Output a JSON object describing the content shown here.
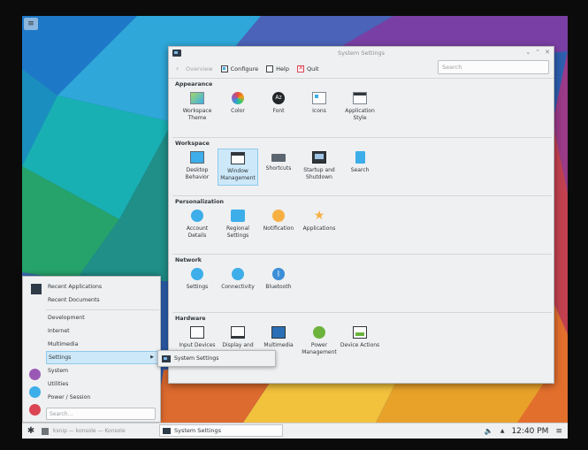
{
  "window": {
    "title": "System Settings",
    "toolbar": {
      "overview": "Overview",
      "configure": "Configure",
      "help": "Help",
      "quit": "Quit"
    },
    "search_placeholder": "Search"
  },
  "sections": [
    {
      "title": "Appearance",
      "items": [
        {
          "label": "Workspace Theme",
          "icon": "workspace-theme-icon"
        },
        {
          "label": "Color",
          "icon": "color-icon"
        },
        {
          "label": "Font",
          "icon": "font-icon",
          "glyph": "Az"
        },
        {
          "label": "Icons",
          "icon": "icons-icon"
        },
        {
          "label": "Application Style",
          "icon": "application-style-icon"
        }
      ]
    },
    {
      "title": "Workspace",
      "items": [
        {
          "label": "Desktop Behavior",
          "icon": "desktop-behavior-icon"
        },
        {
          "label": "Window Management",
          "icon": "window-management-icon",
          "selected": true
        },
        {
          "label": "Shortcuts",
          "icon": "shortcuts-icon"
        },
        {
          "label": "Startup and Shutdown",
          "icon": "startup-shutdown-icon"
        },
        {
          "label": "Search",
          "icon": "search-icon"
        }
      ]
    },
    {
      "title": "Personalization",
      "items": [
        {
          "label": "Account Details",
          "icon": "account-details-icon"
        },
        {
          "label": "Regional Settings",
          "icon": "regional-settings-icon"
        },
        {
          "label": "Notification",
          "icon": "notification-icon"
        },
        {
          "label": "Applications",
          "icon": "applications-star-icon",
          "glyph": "★"
        }
      ]
    },
    {
      "title": "Network",
      "items": [
        {
          "label": "Settings",
          "icon": "network-settings-icon"
        },
        {
          "label": "Connectivity",
          "icon": "connectivity-icon"
        },
        {
          "label": "Bluetooth",
          "icon": "bluetooth-icon",
          "glyph": "ᛒ"
        }
      ]
    },
    {
      "title": "Hardware",
      "items": [
        {
          "label": "Input Devices",
          "icon": "input-devices-icon"
        },
        {
          "label": "Display and",
          "icon": "display-icon"
        },
        {
          "label": "Multimedia",
          "icon": "multimedia-icon"
        },
        {
          "label": "Power Management",
          "icon": "power-management-icon"
        },
        {
          "label": "Device Actions",
          "icon": "device-actions-icon"
        }
      ]
    }
  ],
  "launcher": {
    "recent_applications": "Recent Applications",
    "recent_documents": "Recent Documents",
    "categories": [
      "Development",
      "Internet",
      "Multimedia",
      "Settings",
      "System",
      "Utilities",
      "Power / Session"
    ],
    "active_category": "Settings",
    "search_placeholder": "Search..."
  },
  "submenu": {
    "item": "System Settings"
  },
  "panel": {
    "task_inactive": "ksnip — konsole — Konsole",
    "task_active": "System Settings",
    "clock": "12:40 PM"
  },
  "colors": {
    "accent": "#3daee9",
    "selection": "#cde8f8",
    "window_bg": "#eff0f1"
  }
}
